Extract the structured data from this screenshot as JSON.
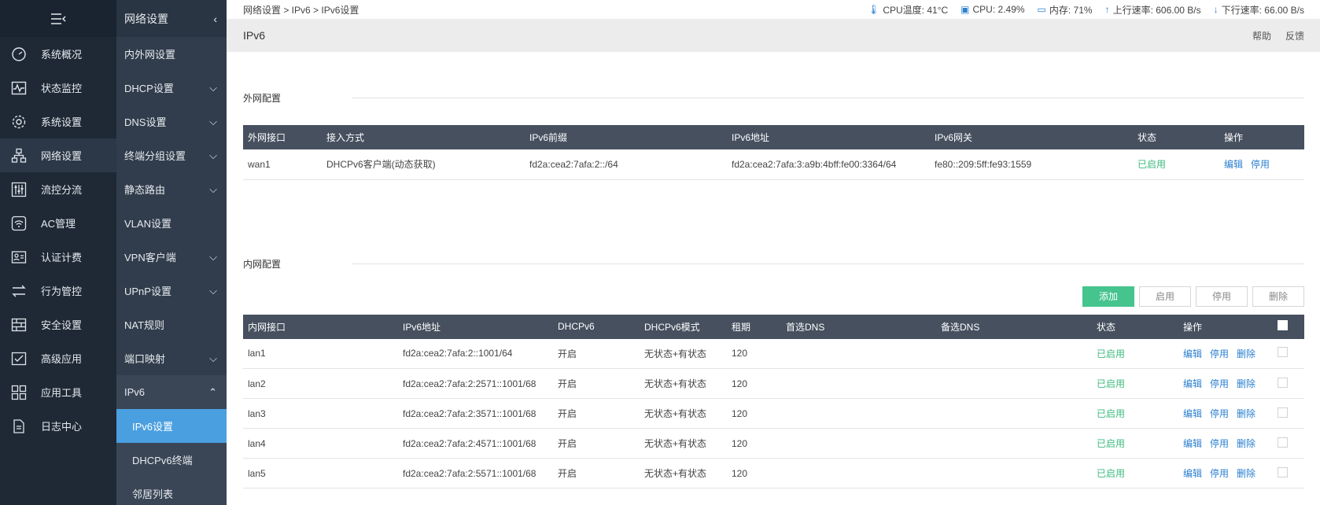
{
  "sidebar": {
    "items": [
      {
        "label": "系统概况",
        "icon": "gauge-icon"
      },
      {
        "label": "状态监控",
        "icon": "pulse-icon"
      },
      {
        "label": "系统设置",
        "icon": "gear-icon"
      },
      {
        "label": "网络设置",
        "icon": "network-icon"
      },
      {
        "label": "流控分流",
        "icon": "sliders-icon"
      },
      {
        "label": "AC管理",
        "icon": "wifi-icon"
      },
      {
        "label": "认证计费",
        "icon": "id-card-icon"
      },
      {
        "label": "行为管控",
        "icon": "arrows-icon"
      },
      {
        "label": "安全设置",
        "icon": "firewall-icon"
      },
      {
        "label": "高级应用",
        "icon": "check-box-icon"
      },
      {
        "label": "应用工具",
        "icon": "apps-icon"
      },
      {
        "label": "日志中心",
        "icon": "document-icon"
      }
    ]
  },
  "subnav": {
    "title": "网络设置",
    "items": [
      {
        "label": "内外网设置"
      },
      {
        "label": "DHCP设置"
      },
      {
        "label": "DNS设置"
      },
      {
        "label": "终端分组设置"
      },
      {
        "label": "静态路由"
      },
      {
        "label": "VLAN设置"
      },
      {
        "label": "VPN客户端"
      },
      {
        "label": "UPnP设置"
      },
      {
        "label": "NAT规则"
      },
      {
        "label": "端口映射"
      },
      {
        "label": "IPv6"
      },
      {
        "label": "IPv6设置"
      },
      {
        "label": "DHCPv6终端"
      },
      {
        "label": "邻居列表"
      }
    ]
  },
  "breadcrumb": "网络设置 > IPv6 > IPv6设置",
  "stats": {
    "cpu_temp": "CPU温度: 41°C",
    "cpu": "CPU: 2.49%",
    "mem": "内存: 71%",
    "up": "上行速率: 606.00 B/s",
    "down": "下行速率: 66.00 B/s"
  },
  "page": {
    "title": "IPv6",
    "help": "帮助",
    "feedback": "反馈"
  },
  "wan": {
    "section_title": "外网配置",
    "headers": [
      "外网接口",
      "接入方式",
      "IPv6前缀",
      "IPv6地址",
      "IPv6网关",
      "状态",
      "操作"
    ],
    "rows": [
      {
        "iface": "wan1",
        "method": "DHCPv6客户端(动态获取)",
        "prefix": "fd2a:cea2:7afa:2::/64",
        "addr": "fd2a:cea2:7afa:3:a9b:4bff:fe00:3364/64",
        "gateway": "fe80::209:5ff:fe93:1559",
        "status": "已启用",
        "edit": "编辑",
        "disable": "停用"
      }
    ]
  },
  "lan": {
    "section_title": "内网配置",
    "buttons": {
      "add": "添加",
      "enable": "启用",
      "disable": "停用",
      "delete": "删除"
    },
    "headers": [
      "内网接口",
      "IPv6地址",
      "DHCPv6",
      "DHCPv6模式",
      "租期",
      "首选DNS",
      "备选DNS",
      "状态",
      "操作"
    ],
    "rows": [
      {
        "iface": "lan1",
        "addr": "fd2a:cea2:7afa:2::1001/64",
        "dhcp": "开启",
        "mode": "无状态+有状态",
        "lease": "120",
        "dns1": "",
        "dns2": "",
        "status": "已启用",
        "edit": "编辑",
        "disable": "停用",
        "delete": "删除"
      },
      {
        "iface": "lan2",
        "addr": "fd2a:cea2:7afa:2:2571::1001/68",
        "dhcp": "开启",
        "mode": "无状态+有状态",
        "lease": "120",
        "dns1": "",
        "dns2": "",
        "status": "已启用",
        "edit": "编辑",
        "disable": "停用",
        "delete": "删除"
      },
      {
        "iface": "lan3",
        "addr": "fd2a:cea2:7afa:2:3571::1001/68",
        "dhcp": "开启",
        "mode": "无状态+有状态",
        "lease": "120",
        "dns1": "",
        "dns2": "",
        "status": "已启用",
        "edit": "编辑",
        "disable": "停用",
        "delete": "删除"
      },
      {
        "iface": "lan4",
        "addr": "fd2a:cea2:7afa:2:4571::1001/68",
        "dhcp": "开启",
        "mode": "无状态+有状态",
        "lease": "120",
        "dns1": "",
        "dns2": "",
        "status": "已启用",
        "edit": "编辑",
        "disable": "停用",
        "delete": "删除"
      },
      {
        "iface": "lan5",
        "addr": "fd2a:cea2:7afa:2:5571::1001/68",
        "dhcp": "开启",
        "mode": "无状态+有状态",
        "lease": "120",
        "dns1": "",
        "dns2": "",
        "status": "已启用",
        "edit": "编辑",
        "disable": "停用",
        "delete": "删除"
      }
    ]
  },
  "colors": {
    "accent": "#4a9fe0",
    "success": "#3cba7e",
    "add_button": "#45c48e",
    "sidebar_bg": "#1f2936",
    "table_header": "#46505f"
  }
}
